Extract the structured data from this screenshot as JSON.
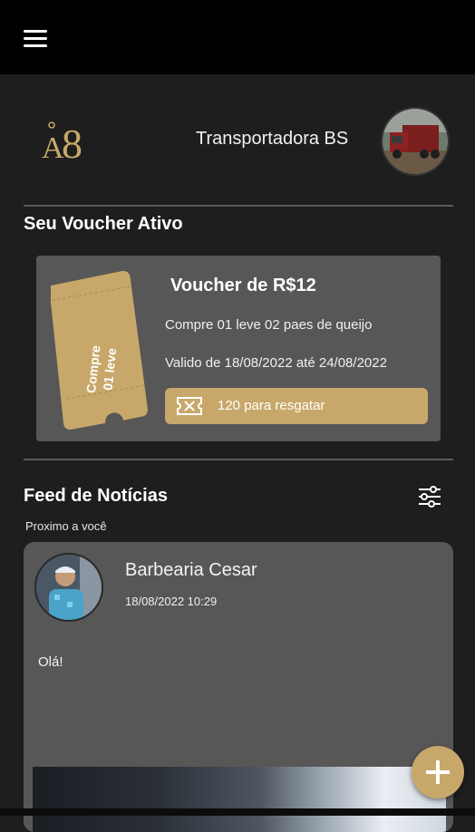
{
  "header": {
    "menu_icon": "hamburger-menu-icon"
  },
  "profile": {
    "logo_text": "A8",
    "company_name": "Transportadora BS",
    "avatar_icon": "truck-avatar"
  },
  "voucher_section": {
    "title": "Seu Voucher Ativo",
    "ticket_text_line1": "Compre",
    "ticket_text_line2": "01 leve",
    "voucher_title": "Voucher de R$12",
    "description": "Compre 01 leve 02 paes de queijo",
    "validity": "Valido de 18/08/2022 até 24/08/2022",
    "redeem_label": "120 para resgatar",
    "redeem_icon": "ticket-icon",
    "accent_color": "#c8a86a"
  },
  "feed": {
    "title": "Feed de Notícias",
    "filter_icon": "sliders-icon",
    "subtitle": "Proximo a você",
    "posts": [
      {
        "author": "Barbearia Cesar",
        "datetime": "18/08/2022 10:29",
        "text": "Olá!"
      }
    ]
  },
  "fab": {
    "icon": "plus-icon"
  }
}
